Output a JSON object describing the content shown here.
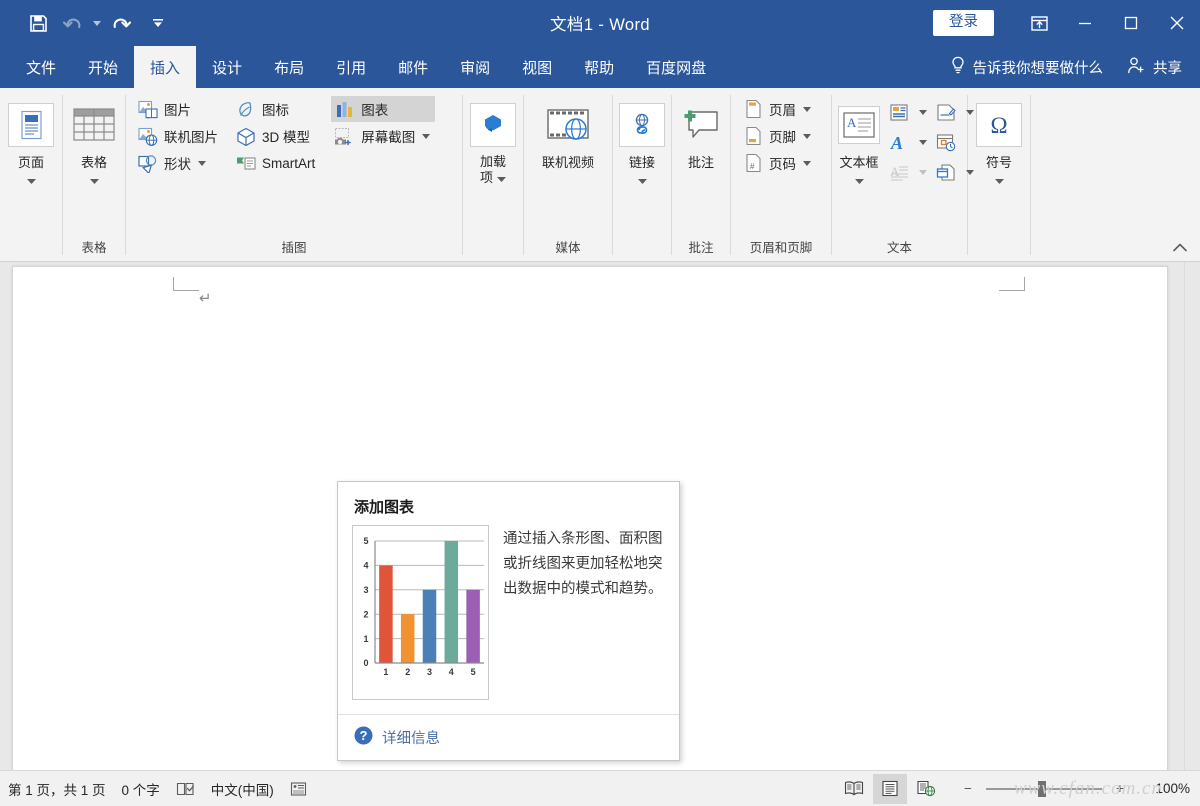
{
  "titlebar": {
    "document_title": "文档1 - Word",
    "signin_label": "登录",
    "quick_access": [
      {
        "name": "save",
        "label": "保存"
      },
      {
        "name": "undo",
        "label": "撤消"
      },
      {
        "name": "redo",
        "label": "恢复"
      },
      {
        "name": "customize",
        "label": "自定义快速访问工具栏"
      }
    ],
    "window_controls": [
      {
        "name": "ribbon-display-options",
        "label": "功能区显示选项"
      },
      {
        "name": "minimize",
        "label": "最小化"
      },
      {
        "name": "maximize",
        "label": "最大化"
      },
      {
        "name": "close",
        "label": "关闭"
      }
    ],
    "accent_color": "#2b579a"
  },
  "tabs": [
    {
      "label": "文件",
      "active": false
    },
    {
      "label": "开始",
      "active": false
    },
    {
      "label": "插入",
      "active": true
    },
    {
      "label": "设计",
      "active": false
    },
    {
      "label": "布局",
      "active": false
    },
    {
      "label": "引用",
      "active": false
    },
    {
      "label": "邮件",
      "active": false
    },
    {
      "label": "审阅",
      "active": false
    },
    {
      "label": "视图",
      "active": false
    },
    {
      "label": "帮助",
      "active": false
    },
    {
      "label": "百度网盘",
      "active": false
    }
  ],
  "tab_right": {
    "tell_me": "告诉我你想要做什么",
    "share": "共享"
  },
  "ribbon": {
    "groups": [
      {
        "name": "pages",
        "label": "",
        "buttons": [
          {
            "name": "pages-button",
            "label": "页面",
            "has_dropdown": true
          }
        ]
      },
      {
        "name": "tables",
        "label": "表格",
        "buttons": [
          {
            "name": "table-button",
            "label": "表格",
            "has_dropdown": true
          }
        ]
      },
      {
        "name": "illustrations",
        "label": "插图",
        "items": [
          {
            "name": "pictures",
            "label": "图片",
            "icon": "picture-icon"
          },
          {
            "name": "online-pictures",
            "label": "联机图片",
            "icon": "online-picture-icon"
          },
          {
            "name": "shapes",
            "label": "形状",
            "icon": "shapes-icon",
            "has_dropdown": true
          },
          {
            "name": "icons",
            "label": "图标",
            "icon": "icons-icon"
          },
          {
            "name": "3d-models",
            "label": "3D 模型",
            "icon": "cube-icon"
          },
          {
            "name": "smartart",
            "label": "SmartArt",
            "icon": "smartart-icon"
          },
          {
            "name": "chart",
            "label": "图表",
            "icon": "chart-icon",
            "highlighted": true
          },
          {
            "name": "screenshot",
            "label": "屏幕截图",
            "icon": "camera-icon",
            "has_dropdown": true
          }
        ]
      },
      {
        "name": "addins",
        "label": "",
        "buttons": [
          {
            "name": "addins-button",
            "label": "加载",
            "label2": "项",
            "has_dropdown": true
          }
        ]
      },
      {
        "name": "media",
        "label": "媒体",
        "buttons": [
          {
            "name": "online-video-button",
            "label": "联机视频"
          }
        ]
      },
      {
        "name": "links",
        "label": "",
        "buttons": [
          {
            "name": "link-button",
            "label": "链接",
            "has_dropdown": true
          }
        ]
      },
      {
        "name": "comments",
        "label": "批注",
        "buttons": [
          {
            "name": "comment-button",
            "label": "批注"
          }
        ]
      },
      {
        "name": "header-footer",
        "label": "页眉和页脚",
        "items": [
          {
            "name": "header",
            "label": "页眉",
            "icon": "header-icon",
            "has_dropdown": true
          },
          {
            "name": "footer",
            "label": "页脚",
            "icon": "footer-icon",
            "has_dropdown": true
          },
          {
            "name": "page-number",
            "label": "页码",
            "icon": "page-number-icon",
            "has_dropdown": true
          }
        ]
      },
      {
        "name": "text",
        "label": "文本",
        "buttons": [
          {
            "name": "text-box-button",
            "label": "文本框",
            "has_dropdown": true
          }
        ],
        "gallery": [
          {
            "name": "quick-parts",
            "icon": "quick-parts-icon",
            "has_dropdown": true
          },
          {
            "name": "signature-line",
            "icon": "signature-icon",
            "has_dropdown": true
          },
          {
            "name": "wordart",
            "icon": "wordart-icon",
            "has_dropdown": true
          },
          {
            "name": "date-time",
            "icon": "date-time-icon"
          },
          {
            "name": "drop-cap",
            "icon": "drop-cap-icon",
            "has_dropdown": true,
            "disabled": true
          },
          {
            "name": "object",
            "icon": "object-icon",
            "has_dropdown": true
          }
        ]
      },
      {
        "name": "symbols",
        "label": "",
        "buttons": [
          {
            "name": "symbol-button",
            "label": "符号",
            "icon": "omega-icon",
            "has_dropdown": true
          }
        ]
      }
    ],
    "collapse_label": "折叠功能区"
  },
  "tooltip": {
    "title": "添加图表",
    "description": "通过插入条形图、面积图或折线图来更加轻松地突出数据中的模式和趋势。",
    "more_info": "详细信息",
    "help_icon": "question-mark-icon"
  },
  "chart_data": {
    "type": "bar",
    "title": "",
    "categories": [
      "1",
      "2",
      "3",
      "4",
      "5"
    ],
    "values": [
      4,
      2,
      3,
      5,
      3
    ],
    "colors": [
      "#e0553a",
      "#f0922f",
      "#4a80b5",
      "#6cab9b",
      "#9c5fb5"
    ],
    "ylim": [
      0,
      5
    ],
    "yticks": [
      0,
      1,
      2,
      3,
      4,
      5
    ],
    "xlabel": "",
    "ylabel": "",
    "grid": true,
    "legend": "none"
  },
  "document": {
    "paragraph_mark": "↵"
  },
  "statusbar": {
    "page_info": "第 1 页，共 1 页",
    "word_count": "0 个字",
    "proofing_icon": "proofing-icon",
    "language": "中文(中国)",
    "accessibility_icon": "accessibility-icon",
    "views": [
      {
        "name": "read-mode",
        "label": "阅读视图",
        "active": false
      },
      {
        "name": "print-layout",
        "label": "页面视图",
        "active": true
      },
      {
        "name": "web-layout",
        "label": "Web 版式视图",
        "active": false
      }
    ],
    "zoom_out": "−",
    "zoom_in": "+",
    "zoom_level": "100%"
  },
  "watermark": "www.cfan.com.cn"
}
